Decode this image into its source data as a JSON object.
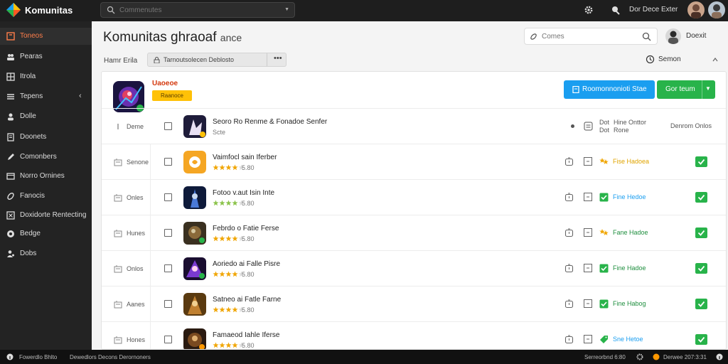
{
  "app": {
    "brand": "Komunitas",
    "top_search": {
      "value": "",
      "placeholder": "Commenutes"
    },
    "top_user": "Dor Dece Exter"
  },
  "sidebar": {
    "items": [
      {
        "label": "Toneos",
        "icon": "home-icon",
        "active": true
      },
      {
        "label": "Pearas",
        "icon": "users-icon"
      },
      {
        "label": "Itrola",
        "icon": "grid-icon"
      },
      {
        "label": "Tepens",
        "icon": "list-icon",
        "has_chevron": true
      },
      {
        "label": "Dolle",
        "icon": "person-icon"
      },
      {
        "label": "Doonets",
        "icon": "document-icon"
      },
      {
        "label": "Comonbers",
        "icon": "pen-icon"
      },
      {
        "label": "Norro Ornines",
        "icon": "window-icon"
      },
      {
        "label": "Fanocis",
        "icon": "link-icon"
      },
      {
        "label": "Doxidorte Rentecting",
        "icon": "close-box-icon"
      },
      {
        "label": "Bedge",
        "icon": "badge-icon"
      },
      {
        "label": "Dobs",
        "icon": "user-group-icon"
      }
    ]
  },
  "main": {
    "title": "Komunitas ghraoaf",
    "title_sub": "ance",
    "search": {
      "value": "",
      "placeholder": "Comes"
    },
    "user": "Doexit",
    "toolbar": {
      "label": "Hamr Erila",
      "group_label": "Tarnoutsolecen Deblosto",
      "sort_label": "Semon"
    }
  },
  "panel": {
    "featured": {
      "title": "Uaoeoe",
      "tag": "Raanoce"
    },
    "buttons": {
      "primary": "Roomonnonioti Stae",
      "secondary": "Gor teum"
    },
    "header": {
      "label": "Deme",
      "title": "Seoro Ro Renme & Fonadoe Senfer",
      "sub": "Scte",
      "col1": "Dot Dot",
      "col2": "Hine Onttor Rone",
      "col3": "Denrom Onlos"
    },
    "rows": [
      {
        "label": "Senone",
        "title": "Vaimfocl sain Iferber",
        "stars": 4,
        "star_color": "#f0a500",
        "rating": "5.80",
        "thumb": "orange",
        "status": "star",
        "status_color": "#f0a500",
        "status_text": "Fise Hadoea",
        "status_text_color": "#e0a400"
      },
      {
        "label": "Onles",
        "title": "Fotoo v.aut Isin Inte",
        "stars": 4,
        "star_color": "#8bc34a",
        "rating": "5.80",
        "thumb": "blue",
        "status": "check",
        "status_color": "#28b34a",
        "status_text": "Fine Hedoe",
        "status_text_color": "#1a9ef0"
      },
      {
        "label": "Hunes",
        "title": "Febrdo o  Fatie Ferse",
        "stars": 4,
        "star_color": "#f0a500",
        "rating": "5.80",
        "thumb": "green",
        "status": "star",
        "status_color": "#f0a500",
        "status_text": "Fane Hadoe",
        "status_text_color": "#1e8e3e"
      },
      {
        "label": "Onlos",
        "title": "Aoriedo ai  Falle Pisre",
        "stars": 4,
        "star_color": "#f0a500",
        "rating": "5.80",
        "thumb": "purple",
        "status": "check",
        "status_color": "#28b34a",
        "status_text": "Fine Hadoe",
        "status_text_color": "#1e8e3e"
      },
      {
        "label": "Aanes",
        "title": "Satneo ai  Fatle Farne",
        "stars": 4,
        "star_color": "#f0a500",
        "rating": "5.80",
        "thumb": "brown",
        "status": "check",
        "status_color": "#28b34a",
        "status_text": "Fine Habog",
        "status_text_color": "#1e8e3e"
      },
      {
        "label": "Hones",
        "title": "Famaeod Iahle Iferse",
        "stars": 4,
        "star_color": "#f0a500",
        "rating": "5.80",
        "thumb": "dark",
        "status": "tag",
        "status_color": "#28b34a",
        "status_text": "Sne Hetoe",
        "status_text_color": "#1a9ef0"
      }
    ]
  },
  "statusbar": {
    "left1": "Fowerdlo Bhlto",
    "left2": "Dewedlors Decons Derornoners",
    "right1": "Serreorbnd 6:80",
    "right2": "Derwee 207:3:31"
  },
  "colors": {
    "accent_orange": "#ff7d4a",
    "blue": "#1a9ef0",
    "green": "#28b34a",
    "yellow": "#ffc107"
  }
}
